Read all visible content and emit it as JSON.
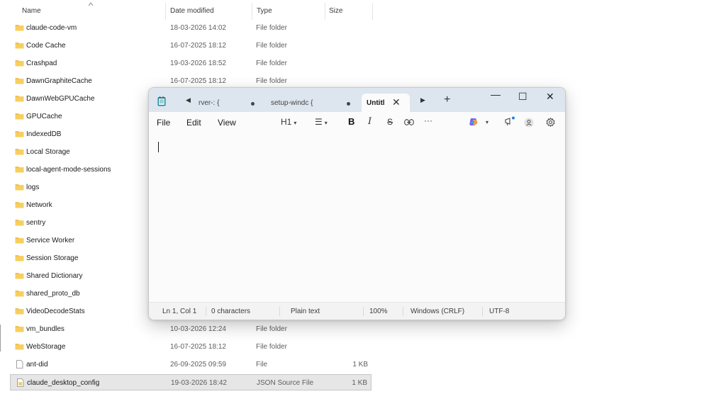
{
  "explorer": {
    "headers": {
      "name": "Name",
      "date": "Date modified",
      "type": "Type",
      "size": "Size"
    },
    "rows": [
      {
        "name": "claude-code-vm",
        "date": "18-03-2026 14:02",
        "type": "File folder",
        "size": "",
        "icon": "folder"
      },
      {
        "name": "Code Cache",
        "date": "16-07-2025 18:12",
        "type": "File folder",
        "size": "",
        "icon": "folder"
      },
      {
        "name": "Crashpad",
        "date": "19-03-2026 18:52",
        "type": "File folder",
        "size": "",
        "icon": "folder"
      },
      {
        "name": "DawnGraphiteCache",
        "date": "16-07-2025 18:12",
        "type": "File folder",
        "size": "",
        "icon": "folder"
      },
      {
        "name": "DawnWebGPUCache",
        "date": "",
        "type": "",
        "size": "",
        "icon": "folder"
      },
      {
        "name": "GPUCache",
        "date": "",
        "type": "",
        "size": "",
        "icon": "folder"
      },
      {
        "name": "IndexedDB",
        "date": "",
        "type": "",
        "size": "",
        "icon": "folder"
      },
      {
        "name": "Local Storage",
        "date": "",
        "type": "",
        "size": "",
        "icon": "folder"
      },
      {
        "name": "local-agent-mode-sessions",
        "date": "",
        "type": "",
        "size": "",
        "icon": "folder"
      },
      {
        "name": "logs",
        "date": "",
        "type": "",
        "size": "",
        "icon": "folder"
      },
      {
        "name": "Network",
        "date": "",
        "type": "",
        "size": "",
        "icon": "folder"
      },
      {
        "name": "sentry",
        "date": "",
        "type": "",
        "size": "",
        "icon": "folder"
      },
      {
        "name": "Service Worker",
        "date": "",
        "type": "",
        "size": "",
        "icon": "folder"
      },
      {
        "name": "Session Storage",
        "date": "",
        "type": "",
        "size": "",
        "icon": "folder"
      },
      {
        "name": "Shared Dictionary",
        "date": "",
        "type": "",
        "size": "",
        "icon": "folder"
      },
      {
        "name": "shared_proto_db",
        "date": "",
        "type": "",
        "size": "",
        "icon": "folder"
      },
      {
        "name": "VideoDecodeStats",
        "date": "",
        "type": "",
        "size": "",
        "icon": "folder"
      },
      {
        "name": "vm_bundles",
        "date": "10-03-2026 12:24",
        "type": "File folder",
        "size": "",
        "icon": "folder"
      },
      {
        "name": "WebStorage",
        "date": "16-07-2025 18:12",
        "type": "File folder",
        "size": "",
        "icon": "folder"
      },
      {
        "name": "ant-did",
        "date": "26-09-2025 09:59",
        "type": "File",
        "size": "1 KB",
        "icon": "file"
      },
      {
        "name": "claude_desktop_config",
        "date": "19-03-2026 18:42",
        "type": "JSON Source File",
        "size": "1 KB",
        "icon": "json-file",
        "selected": true
      }
    ]
  },
  "notepad": {
    "tabs": [
      {
        "label": "rver-: {"
      },
      {
        "label": "setup-windc {"
      },
      {
        "label": "Untitl",
        "active": true
      }
    ],
    "window_controls": {
      "minimize": "—",
      "maximize": "☐",
      "close": "✕"
    },
    "menu": {
      "file": "File",
      "edit": "Edit",
      "view": "View"
    },
    "toolbar": {
      "heading": "H1",
      "list": "☰",
      "bold": "B",
      "italic": "I",
      "strike": "S",
      "link": "⊖",
      "more": "···"
    },
    "status": {
      "position": "Ln 1, Col 1",
      "characters": "0 characters",
      "format": "Plain text",
      "zoom": "100%",
      "line_ending": "Windows (CRLF)",
      "encoding": "UTF-8"
    }
  },
  "colors": {
    "folder": "#f2c14b",
    "titlebar": "#dde5ee",
    "notepad_icon": "#1f8a9e"
  }
}
